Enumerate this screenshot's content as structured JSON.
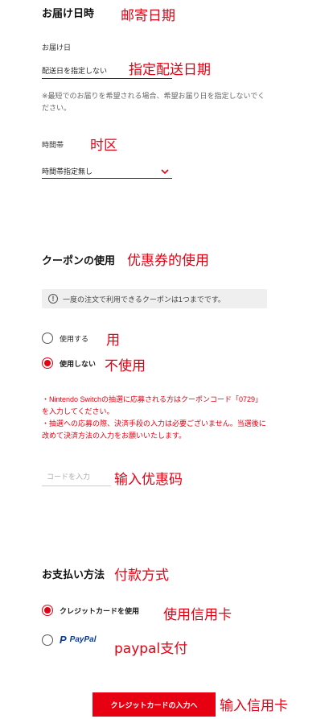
{
  "delivery": {
    "title": "お届け日時",
    "title_anno": "邮寄日期",
    "date_label": "お届け日",
    "date_select": "配送日を指定しない",
    "date_anno": "指定配送日期",
    "note": "※最短でのお届りを希望される場合、希望お届り日を指定しないでください。",
    "time_label": "時間帯",
    "time_anno": "时区",
    "time_select": "時間帯指定無し"
  },
  "coupon": {
    "title": "クーポンの使用",
    "title_anno": "优惠券的使用",
    "info": "一度の注文で利用できるクーポンは1つまでです。",
    "options": [
      {
        "label": "使用する",
        "anno": "用",
        "selected": false
      },
      {
        "label": "使用しない",
        "anno": "不使用",
        "selected": true
      }
    ],
    "warning_1": "・Nintendo Switchの抽選に応募される方はクーポンコード「0729」を入力してください。",
    "warning_2": "・抽選への応募の際、決済手段の入力は必要ございません。当選後に改めて決済方法の入力をお願いいたします。",
    "code_placeholder": "コードを入力",
    "code_anno": "输入优惠码"
  },
  "payment": {
    "title": "お支払い方法",
    "title_anno": "付款方式",
    "options": [
      {
        "label": "クレジットカードを使用",
        "anno": "使用信用卡",
        "selected": true
      },
      {
        "label_p": "P",
        "label": "PayPal",
        "anno": "paypal支付",
        "selected": false
      }
    ],
    "submit": "クレジットカードの入力へ",
    "submit_anno": "输入信用卡"
  },
  "colors": {
    "accent": "#e60012",
    "paypal": "#0d3b8e",
    "paypal_light": "#1a9fda"
  }
}
